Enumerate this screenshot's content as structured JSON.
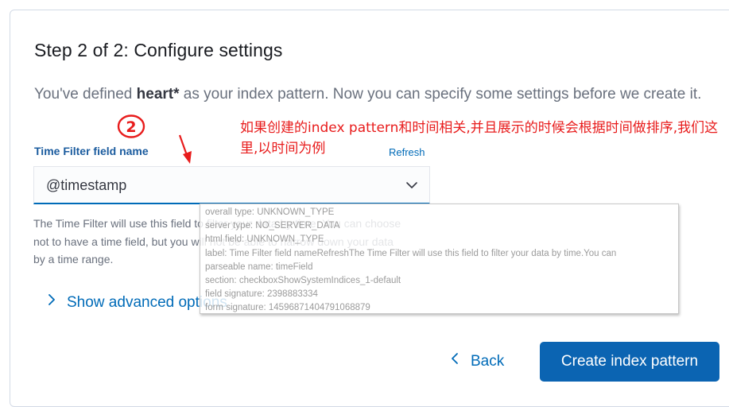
{
  "header": {
    "title": "Step 2 of 2: Configure settings",
    "desc_prefix": "You've defined ",
    "desc_pattern": "heart*",
    "desc_suffix": " as your index pattern. Now you can specify some settings before we create it."
  },
  "time_field": {
    "label": "Time Filter field name",
    "refresh_label": "Refresh",
    "value": "@timestamp",
    "help_text": "The Time Filter will use this field to filter your data by time. You can choose not to have a time field, but you will not be able to narrow down your data by a time range."
  },
  "advanced": {
    "label": "Show advanced options"
  },
  "footer": {
    "back_label": "Back",
    "create_label": "Create index pattern"
  },
  "annotation": {
    "number": "2",
    "note": "如果创建的index pattern和时间相关,并且展示的时候会根据时间做排序,我们这里,以时间为例"
  },
  "tooltip": {
    "lines": [
      "overall type: UNKNOWN_TYPE",
      "server type: NO_SERVER_DATA",
      "html field: UNKNOWN_TYPE",
      "label: Time Filter field nameRefreshThe Time Filter will use this field to filter your data by time.You can",
      "parseable name: timeField",
      "section: checkboxShowSystemIndices_1-default",
      "field signature: 2398883334",
      "form signature: 14596871404791068879"
    ]
  },
  "colors": {
    "accent": "#006bb8",
    "primary_button": "#0b64b2",
    "annotation": "#e81c1c"
  }
}
